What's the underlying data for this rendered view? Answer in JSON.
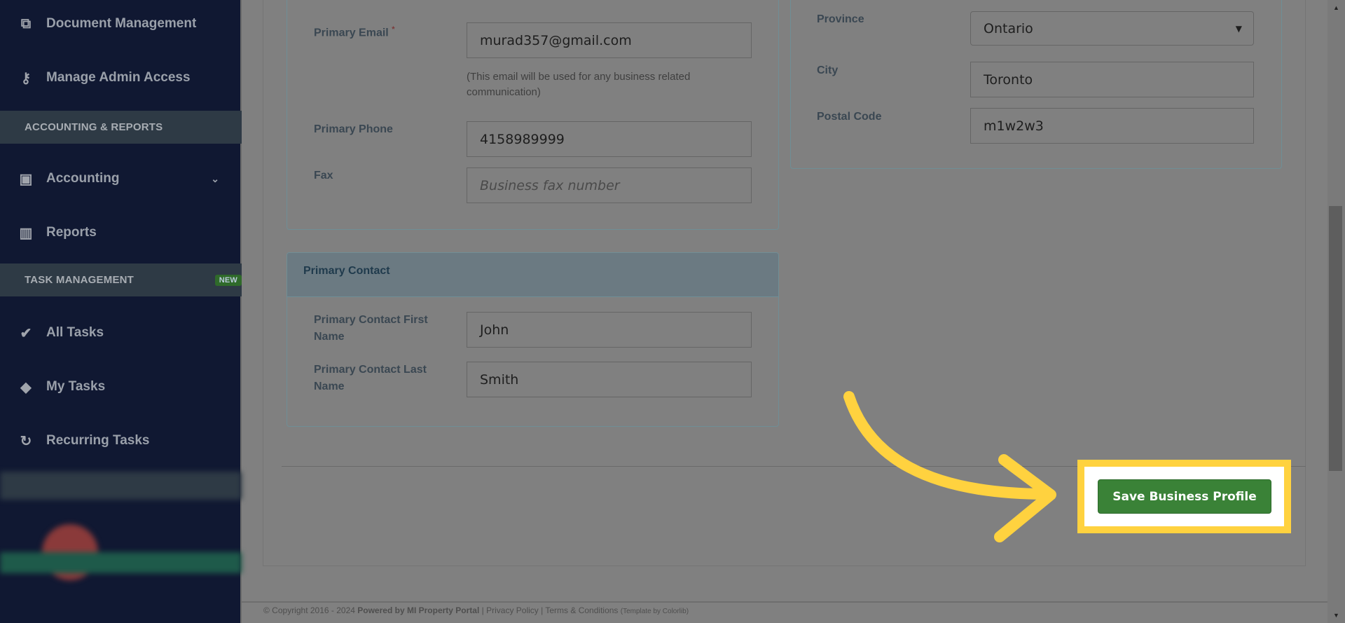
{
  "sidebar": {
    "items": [
      {
        "label": "Document Management",
        "icon": "documents-icon"
      },
      {
        "label": "Manage Admin Access",
        "icon": "key-icon"
      },
      {
        "label": "Accounting",
        "icon": "money-icon"
      },
      {
        "label": "Reports",
        "icon": "bar-chart-icon"
      },
      {
        "label": "All Tasks",
        "icon": "check-icon"
      },
      {
        "label": "My Tasks",
        "icon": "tag-icon"
      },
      {
        "label": "Recurring Tasks",
        "icon": "refresh-icon"
      }
    ],
    "sections": [
      {
        "label": "ACCOUNTING & REPORTS"
      },
      {
        "label": "TASK MANAGEMENT",
        "badge": "NEW"
      }
    ]
  },
  "business": {
    "email_label": "Primary Email",
    "required": "*",
    "email": "murad357@gmail.com",
    "email_help": "(This email will be used for any business related communication)",
    "phone_label": "Primary Phone",
    "phone": "4158989999",
    "fax_label": "Fax",
    "fax_placeholder": "Business fax number"
  },
  "address": {
    "province_label": "Province",
    "province": "Ontario",
    "city_label": "City",
    "city": "Toronto",
    "postal_label": "Postal Code",
    "postal": "m1w2w3"
  },
  "contact": {
    "title": "Primary Contact",
    "first_label": "Primary Contact First Name",
    "first": "John",
    "last_label": "Primary Contact Last Name",
    "last": "Smith"
  },
  "save_label": "Save Business Profile",
  "footer": {
    "copyright": "© Copyright 2016 - 2024",
    "powered": "Powered by MI Property Portal",
    "privacy": "Privacy Policy",
    "terms": "Terms & Conditions",
    "template": "(Template by Colorlib)"
  },
  "colors": {
    "highlight": "#ffd23f",
    "save": "#3a8237",
    "sidebar": "#101832"
  }
}
